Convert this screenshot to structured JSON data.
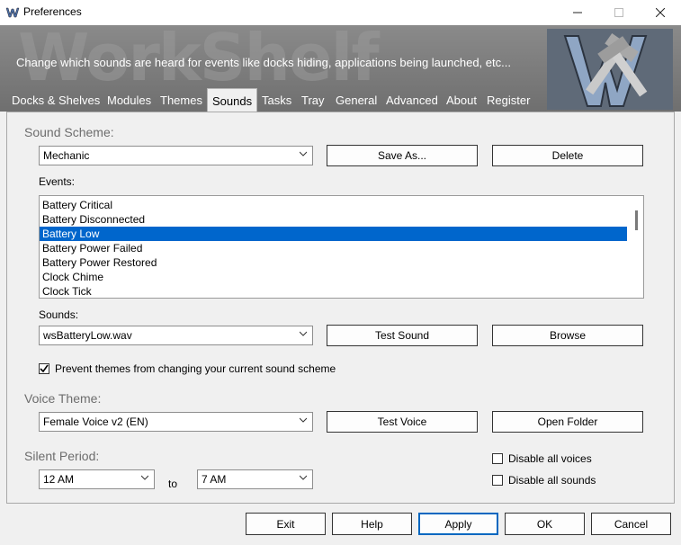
{
  "window": {
    "title": "Preferences"
  },
  "banner": {
    "watermark": "WorkShelf",
    "description": "Change which sounds are heard for events like docks hiding, applications being launched, etc..."
  },
  "tabs": [
    "Docks & Shelves",
    "Modules",
    "Themes",
    "Sounds",
    "Tasks",
    "Tray",
    "General",
    "Advanced",
    "About",
    "Register"
  ],
  "active_tab": "Sounds",
  "sound_scheme": {
    "label": "Sound Scheme:",
    "value": "Mechanic",
    "save_as": "Save As...",
    "delete": "Delete"
  },
  "events": {
    "label": "Events:",
    "items": [
      "Battery Critical",
      "Battery Disconnected",
      "Battery Low",
      "Battery Power Failed",
      "Battery Power Restored",
      "Clock Chime",
      "Clock Tick"
    ],
    "selected": "Battery Low"
  },
  "sounds": {
    "label": "Sounds:",
    "value": "wsBatteryLow.wav",
    "test": "Test Sound",
    "browse": "Browse"
  },
  "prevent_themes": {
    "label": "Prevent themes from changing your current sound scheme",
    "checked": true
  },
  "voice_theme": {
    "label": "Voice Theme:",
    "value": "Female Voice v2 (EN)",
    "test": "Test Voice",
    "open_folder": "Open Folder"
  },
  "silent_period": {
    "label": "Silent Period:",
    "from": "12 AM",
    "to_label": "to",
    "to": "7 AM"
  },
  "disable_voices": {
    "label": "Disable all voices",
    "checked": false
  },
  "disable_sounds": {
    "label": "Disable all sounds",
    "checked": false
  },
  "footer": {
    "exit": "Exit",
    "help": "Help",
    "apply": "Apply",
    "ok": "OK",
    "cancel": "Cancel"
  },
  "colors": {
    "selection": "#0066cc",
    "banner": "#7a7a7a",
    "apply_border": "#0067c0"
  }
}
